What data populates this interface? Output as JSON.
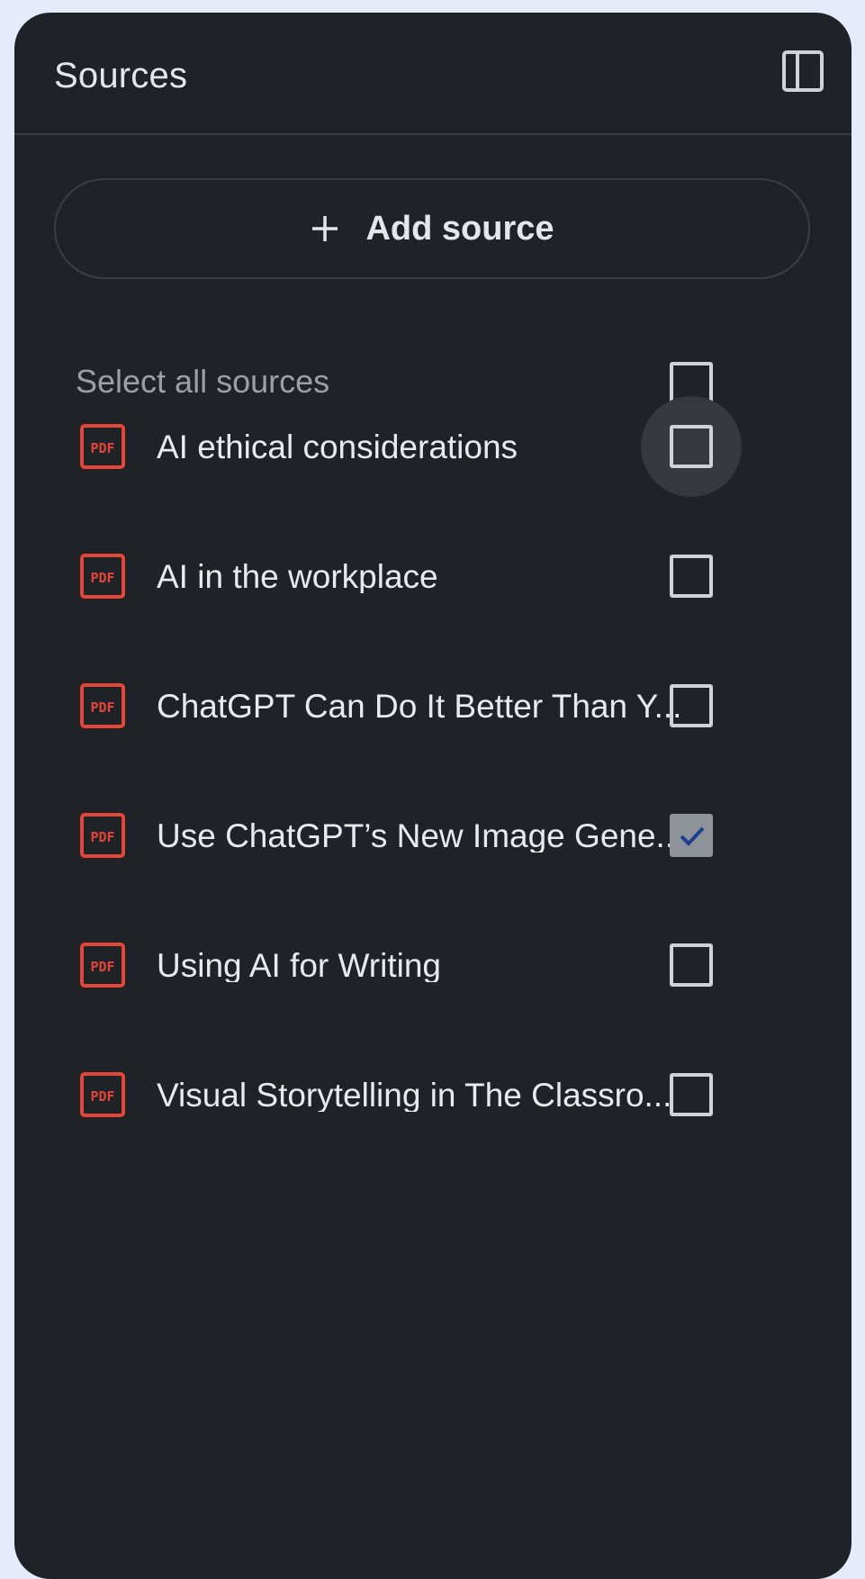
{
  "panel": {
    "title": "Sources",
    "collapse_icon": "sidebar-collapse-icon"
  },
  "add_source": {
    "icon": "plus-icon",
    "label": "Add source"
  },
  "select_all": {
    "label": "Select all sources",
    "checked": false
  },
  "sources": [
    {
      "title": "AI ethical considerations",
      "icon": "pdf-icon",
      "checked": false,
      "hovered": true
    },
    {
      "title": "AI in the workplace",
      "icon": "pdf-icon",
      "checked": false,
      "hovered": false
    },
    {
      "title": "ChatGPT Can Do It Better Than Y...",
      "icon": "pdf-icon",
      "checked": false,
      "hovered": false
    },
    {
      "title": "Use ChatGPT’s New Image Gene...",
      "icon": "pdf-icon",
      "checked": true,
      "hovered": false
    },
    {
      "title": "Using AI for Writing",
      "icon": "pdf-icon",
      "checked": false,
      "hovered": false
    },
    {
      "title": "Visual Storytelling in The Classro...",
      "icon": "pdf-icon",
      "checked": false,
      "hovered": false
    }
  ],
  "colors": {
    "page_background": "#e6ebfb",
    "panel_background": "#1f2226",
    "pdf_icon": "#e2463b",
    "checked_fill": "#8e9299",
    "check_mark": "#1a3f8f"
  }
}
